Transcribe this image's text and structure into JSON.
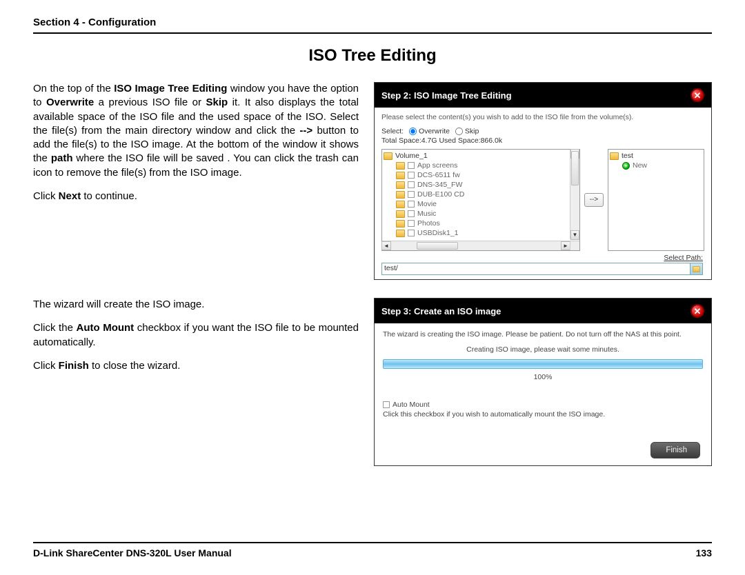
{
  "header": {
    "section": "Section 4 - Configuration"
  },
  "title": "ISO Tree Editing",
  "para1": {
    "t1": "On the top of the ",
    "b1": "ISO Image Tree Editing",
    "t2": " window you have the option to ",
    "b2": "Overwrite",
    "t3": " a previous ISO file or ",
    "b3": "Skip",
    "t4": " it.  It also displays the total available space of the ISO file and the used space of the ISO. Select the file(s) from the main directory window and click the ",
    "b4": "-->",
    "t5": " button to add the file(s) to the ISO image. At the bottom of the window it shows the ",
    "b5": "path",
    "t6": " where the ISO file will be saved .  You can click the trash can icon to remove the file(s) from the ISO image."
  },
  "para2": {
    "t1": "Click ",
    "b1": "Next",
    "t2": " to continue."
  },
  "para3": "The wizard will create the ISO image.",
  "para4": {
    "t1": "Click the ",
    "b1": "Auto Mount",
    "t2": " checkbox if you want the ISO file to be mounted automatically."
  },
  "para5": {
    "t1": "Click ",
    "b1": "Finish",
    "t2": " to close the wizard."
  },
  "step2": {
    "title": "Step 2: ISO Image Tree Editing",
    "instruction": "Please select the content(s) you wish to add to the ISO file from the volume(s).",
    "select_label": "Select:",
    "overwrite": "Overwrite",
    "skip": "Skip",
    "space": "Total Space:4.7G Used Space:866.0k",
    "move_btn": "-->",
    "left_root": "Volume_1",
    "left_items": [
      "App screens",
      "DCS-6511 fw",
      "DNS-345_FW",
      "DUB-E100 CD",
      "Movie",
      "Music",
      "Photos",
      "USBDisk1_1"
    ],
    "right_root": "test",
    "right_new": "New",
    "select_path_label": "Select Path:",
    "path_value": "test/"
  },
  "step3": {
    "title": "Step 3: Create an ISO image",
    "instruction": "The wizard is creating the ISO image. Please be patient. Do not turn off the NAS at this point.",
    "creating": "Creating ISO image, please wait some minutes.",
    "percent": "100%",
    "automount": "Auto Mount",
    "automount_desc": "Click this checkbox if you wish to automatically mount the ISO image.",
    "finish": "Finish"
  },
  "footer": {
    "manual": "D-Link ShareCenter DNS-320L User Manual",
    "page": "133"
  }
}
